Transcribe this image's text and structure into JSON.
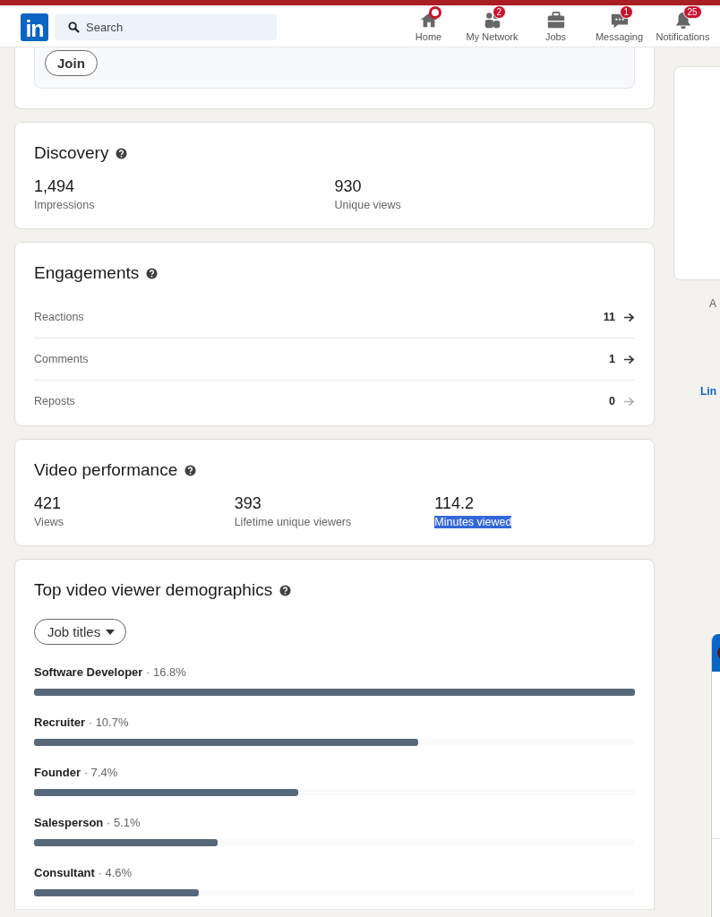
{
  "header": {
    "logo": "in",
    "search": {
      "placeholder": "Search"
    },
    "nav": [
      {
        "label": "Home",
        "dot": true
      },
      {
        "label": "My Network",
        "badge": "2"
      },
      {
        "label": "Jobs"
      },
      {
        "label": "Messaging",
        "badge": "1"
      },
      {
        "label": "Notifications",
        "badge": "25"
      }
    ]
  },
  "group_card": {
    "button": "Join"
  },
  "discovery": {
    "title": "Discovery",
    "stats": [
      {
        "value": "1,494",
        "label": "Impressions",
        "highlighted": false
      },
      {
        "value": "930",
        "label": "Unique views",
        "highlighted": false
      }
    ]
  },
  "engagements": {
    "title": "Engagements",
    "rows": [
      {
        "label": "Reactions",
        "value": "11",
        "disabled": false
      },
      {
        "label": "Comments",
        "value": "1",
        "disabled": false
      },
      {
        "label": "Reposts",
        "value": "0",
        "disabled": true
      }
    ]
  },
  "video_performance": {
    "title": "Video performance",
    "stats": [
      {
        "value": "421",
        "label": "Views",
        "highlighted": false
      },
      {
        "value": "393",
        "label": "Lifetime unique viewers",
        "highlighted": false
      },
      {
        "value": "114.2",
        "label": "Minutes viewed",
        "highlighted": true
      }
    ]
  },
  "demographics": {
    "title": "Top video viewer demographics",
    "filter": "Job titles",
    "rows": [
      {
        "name": "Software Developer",
        "share": "· 16.8%",
        "level": 1.0
      },
      {
        "name": "Recruiter",
        "share": "· 10.7%",
        "level": 0.64
      },
      {
        "name": "Founder",
        "share": "· 7.4%",
        "level": 0.44
      },
      {
        "name": "Salesperson",
        "share": "· 5.1%",
        "level": 0.305
      },
      {
        "name": "Consultant",
        "share": "· 4.6%",
        "level": 0.274
      }
    ]
  },
  "right_rail": {
    "texts": [
      {
        "text": "A",
        "kind": "caption"
      },
      {
        "text": "Lin",
        "kind": "link"
      }
    ]
  }
}
